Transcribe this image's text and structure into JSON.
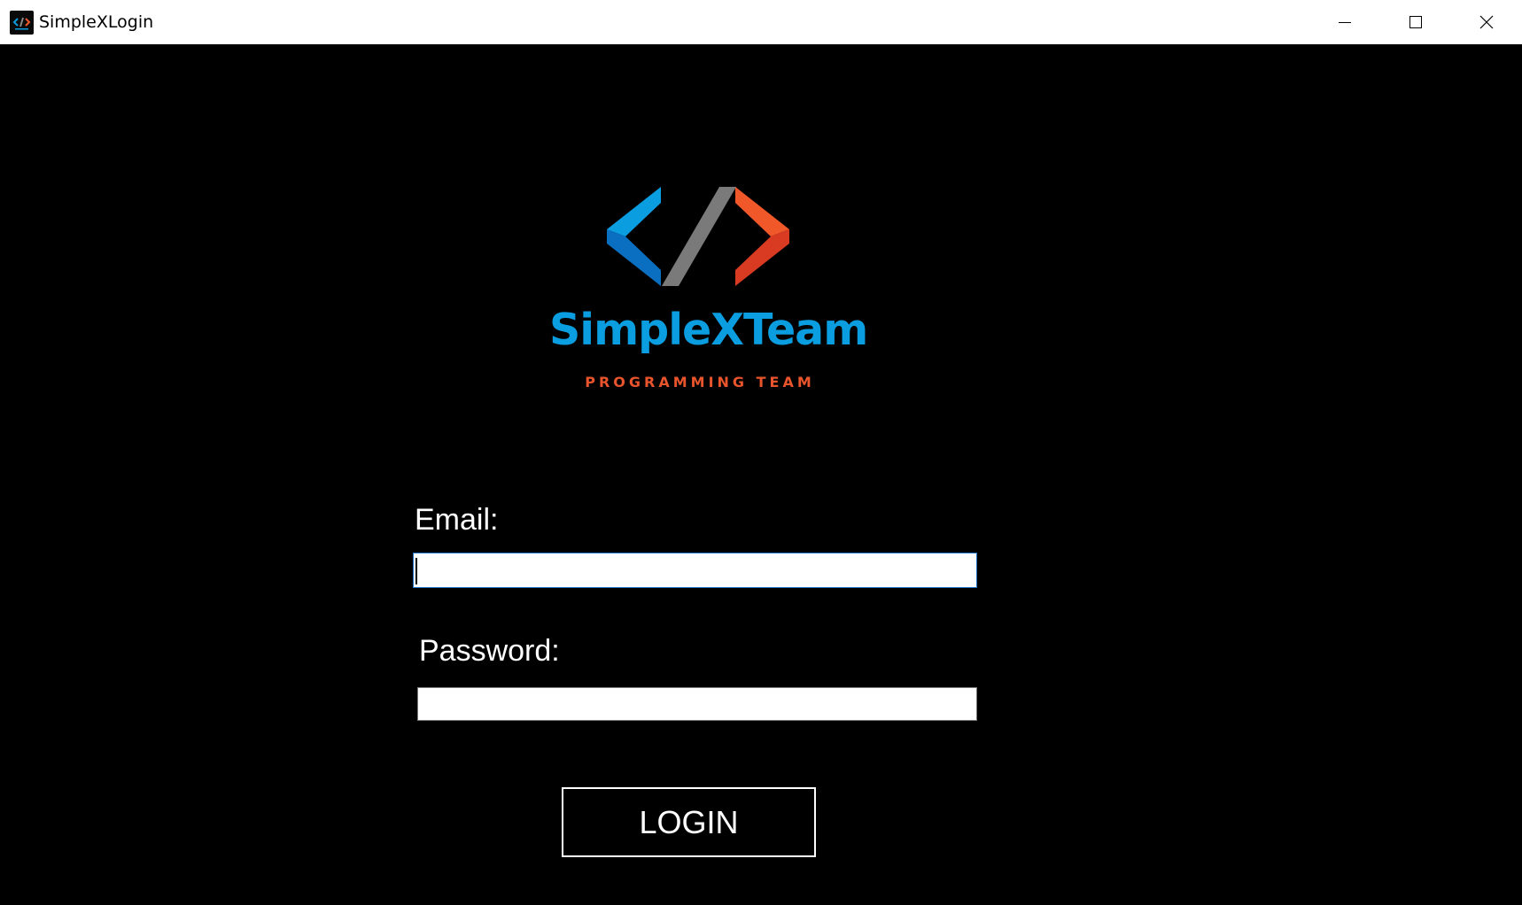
{
  "window": {
    "title": "SimpleXLogin",
    "controls": {
      "minimize": "minimize-icon",
      "maximize": "maximize-icon",
      "close": "close-icon"
    }
  },
  "brand": {
    "name": "SimpleXTeam",
    "tagline": "PROGRAMMING TEAM",
    "colors": {
      "blue": "#0a9de0",
      "blue_dark": "#0a6fc0",
      "gray": "#7a7a7a",
      "orange": "#f0582a",
      "orange_dark": "#d83a22"
    }
  },
  "form": {
    "email_label": "Email:",
    "email_value": "",
    "password_label": "Password:",
    "password_value": "",
    "login_label": "LOGIN"
  }
}
